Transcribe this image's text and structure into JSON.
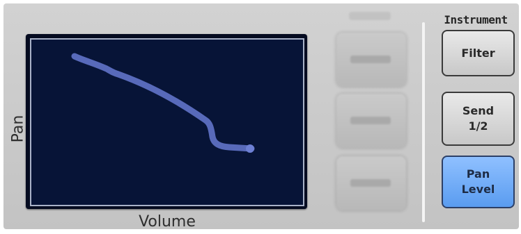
{
  "xy_pad": {
    "x_axis_label": "Volume",
    "y_axis_label": "Pan",
    "trail_color": "#5f72c6",
    "background_color": "#071437"
  },
  "left_button_group": {
    "header_label": "",
    "buttons": [
      {
        "label": ""
      },
      {
        "label": ""
      },
      {
        "label": ""
      }
    ]
  },
  "instrument": {
    "section_label": "Instrument",
    "buttons": [
      {
        "label": "Filter",
        "selected": false
      },
      {
        "label": "Send\n1/2",
        "selected": false
      },
      {
        "label": "Pan\nLevel",
        "selected": true
      }
    ],
    "selected_color": "#6aa8f7"
  }
}
